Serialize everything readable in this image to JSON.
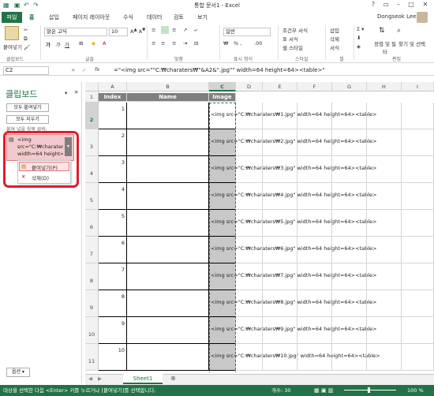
{
  "window": {
    "title": "통합 문서1 - Excel",
    "user": "Dongseok Lee"
  },
  "tabs": [
    "파일",
    "홈",
    "삽입",
    "페이지 레이아웃",
    "수식",
    "데이터",
    "검토",
    "보기"
  ],
  "ribbon": {
    "paste": "붙여넣기",
    "font_name": "맑은 고딕",
    "font_size": "10",
    "number_format": "일반",
    "percent": "% ,",
    "cond_format": "조건부 서식",
    "table_format": "표 서식",
    "cell_style": "셀 스타일",
    "insert": "삽입",
    "delete": "삭제",
    "format": "서식",
    "sort_filter": "정렬 및 필터",
    "find_select": "찾기 및 선택",
    "groups": [
      "클립보드",
      "글꼴",
      "맞춤",
      "표시 형식",
      "스타일",
      "셀",
      "편집"
    ]
  },
  "formula_bar": {
    "name_box": "C2",
    "formula": "=\"<img src=\"\"C:₩charaters₩\"&A2&\".jpg\"\" width=64 height=64><table>\""
  },
  "clipboard": {
    "title": "클립보드",
    "paste_all": "모두 붙여넣기",
    "clear_all": "모두 지우기",
    "hint": "붙여 넣을 항목 클릭:",
    "item_lines": [
      "<img",
      "src=\"C:₩charaters",
      "width=64 height=6"
    ],
    "menu_paste": "붙여넣기(P)",
    "menu_delete": "삭제(D)",
    "options": "옵션 ▾"
  },
  "sheet": {
    "columns": [
      "A",
      "B",
      "C",
      "D",
      "E",
      "F",
      "G",
      "H",
      "I"
    ],
    "headers": {
      "index": "Index",
      "name": "Name",
      "image": "Image"
    },
    "rows": [
      {
        "num": "2",
        "index": "1",
        "text": "<img src=\"C:₩charaters₩1.jpg\" width=64 height=64><table>"
      },
      {
        "num": "3",
        "index": "2",
        "text": "<img src=\"C:₩charaters₩2.jpg\" width=64 height=64><table>"
      },
      {
        "num": "4",
        "index": "3",
        "text": "<img src=\"C:₩charaters₩3.jpg\" width=64 height=64><table>"
      },
      {
        "num": "5",
        "index": "4",
        "text": "<img src=\"C:₩charaters₩4.jpg\" width=64 height=64><table>"
      },
      {
        "num": "6",
        "index": "5",
        "text": "<img src=\"C:₩charaters₩5.jpg\" width=64 height=64><table>"
      },
      {
        "num": "7",
        "index": "6",
        "text": "<img src=\"C:₩charaters₩6.jpg\" width=64 height=64><table>"
      },
      {
        "num": "8",
        "index": "7",
        "text": "<img src=\"C:₩charaters₩7.jpg\" width=64 height=64><table>"
      },
      {
        "num": "9",
        "index": "8",
        "text": "<img src=\"C:₩charaters₩8.jpg\" width=64 height=64><table>"
      },
      {
        "num": "10",
        "index": "9",
        "text": "<img src=\"C:₩charaters₩9.jpg\" width=64 height=64><table>"
      },
      {
        "num": "11",
        "index": "10",
        "text": "<img src=\"C:₩charaters₩10.jpg\" width=64 height=64><table>"
      }
    ],
    "first_row_num": "1",
    "sheet_tab": "Sheet1"
  },
  "status": {
    "message": "대상을 선택한 다음 <Enter> 키를 누르거나 [붙여넣기]를 선택합니다.",
    "count": "개수: 30",
    "zoom": "100 %"
  },
  "colors": {
    "excel_green": "#217346",
    "highlight_red": "#e21b2c",
    "header_gray": "#7f7f7f"
  }
}
